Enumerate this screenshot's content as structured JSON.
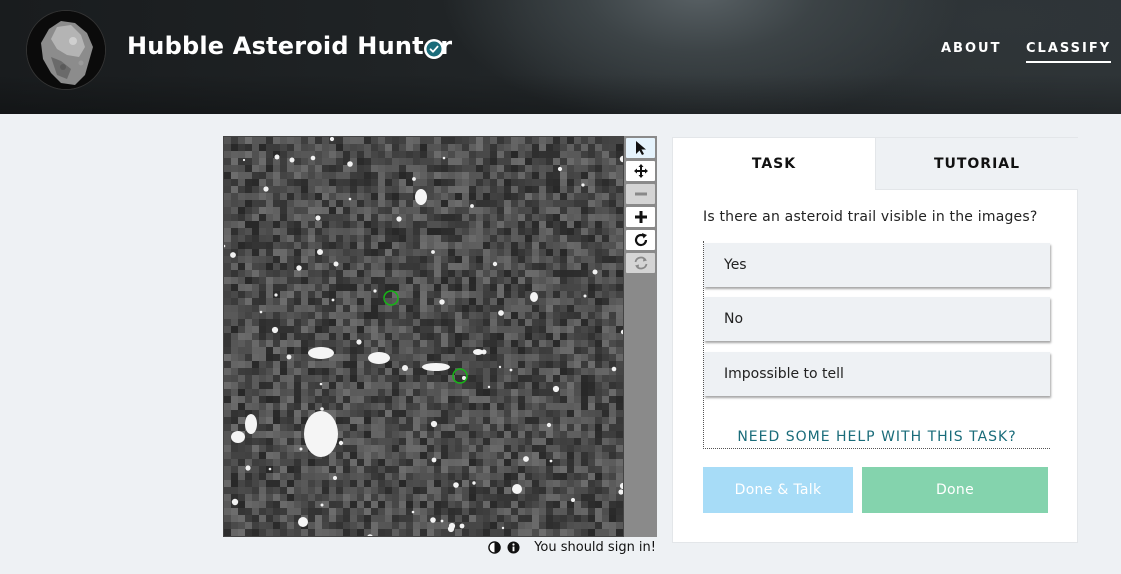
{
  "header": {
    "title": "Hubble Asteroid Hunter",
    "nav": {
      "about": "ABOUT",
      "classify": "CLASSIFY"
    }
  },
  "viewer": {
    "tools": [
      "pointer-icon",
      "move-icon",
      "zoom-out-icon",
      "zoom-in-icon",
      "rotate-icon",
      "reset-icon"
    ],
    "footer": {
      "signin": "You should sign in!"
    }
  },
  "task": {
    "tabs": {
      "task": "TASK",
      "tutorial": "TUTORIAL"
    },
    "question": "Is there an asteroid trail visible in the images?",
    "answers": [
      "Yes",
      "No",
      "Impossible to tell"
    ],
    "help": "NEED SOME HELP WITH THIS TASK?",
    "buttons": {
      "done_talk": "Done & Talk",
      "done": "Done"
    }
  },
  "colors": {
    "accent": "#1a6c7a",
    "done_talk_bg": "#a7dcf7",
    "done_bg": "#84d3ad",
    "marker": "#17b517"
  }
}
